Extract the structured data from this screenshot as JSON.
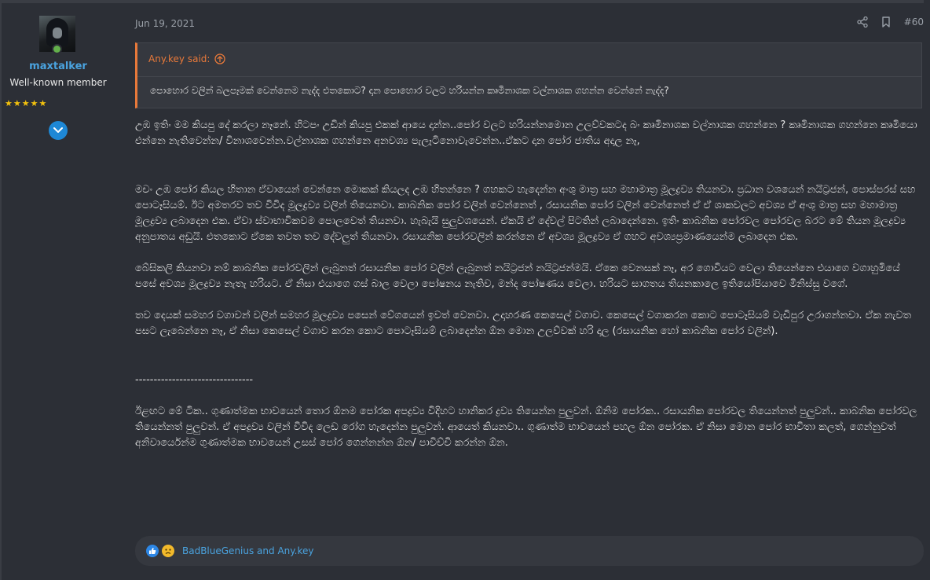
{
  "user": {
    "name": "maxtalker",
    "title": "Well-known member",
    "stars": "★★★★★",
    "avatar_icon": "user-avatar",
    "online_color": "#63b04b"
  },
  "post": {
    "date": "Jun 19, 2021",
    "number": "#60"
  },
  "quote": {
    "author": "Any.key said:",
    "text": "පොහොර වලින් බලපෑමක් වෙන්නෙම නැද්ද එතකොට? දාන පොහොර වලට හරියන්න කෘමිනාශක වල්නාශක ගහන්න වෙන්නේ නැද්ද?"
  },
  "body": {
    "p1": "උඹ ඉතිං මම කියපු දේ කරලා නෑනේ. හිටපං උඩින් කියපු එකක් ආයෙ දාන්න..පෝර වලට හරියන්නමොන උලව්වකටද බං කෘමිනාශක වල්නාශක ගහන්නෙ ? කෘමිනාශක ගහන්නෙ කෘමියො එන්නෙ නැතිවෙන්න/ විනාශවෙන්න.වල්නාශක ගහන්නෙ අනවශ්‍ය පැලෑටිනොවැවෙන්න..ඒකට දාන පෝර ජාතිය අදාල නෑ,",
    "p2": "මචං උඹ පෝර කියල හිතාන ඒවායෙන් වෙන්නෙ මොකක් කියලද උඹ හිතන්නෙ ? ගහකට හැදෙන්න අංශු මාත්‍ර සහ මහාමාත්‍ර මූලද්‍රව්‍ය තියනවා. ප්‍රධාන වශයෙන් නයිට්‍රජන්, පොස්පරස් සහ පොටෑසියම්. ඊට අමතරව තව විවිද මූලද්‍රව්‍ය වලින් තියෙනවා. කාබනික පෝර වලින් වෙන්නෙත් , රසායනික පෝර වලින් වෙන්නෙත් ඒ ඒ ශාකවලට අවශ්‍ය ඒ අංශු මාත්‍ර සහ මහාමාත්‍ර මූලද්‍රව්‍ය ලබාදෙන එක. ඒවා ස්වාභාවිකවම පොලවෙත් තියනවා. හැබැයි සුලුවශයෙන්. ඒකයි ඒ දේවල් පිටතින් ලබාදෙන්නෙ. ඉතිං කාබනික පෝරවල පෝරවල බරට මේ තියන මූලද්‍රව්‍ය අනුපාතය අඩුයි. එතකොට ඒකෙ තවත තව දේවලුත් තියනවා. රසායනික පෝරවලින් කරන්නෙ ඒ අවශ්‍ය මූලද්‍රව්‍ය ඒ ගහට අවශ්‍යප්‍රමාණයෙන්ම ලබාදෙන එක.",
    "p3": "බේසිකලි කියනවා නම් කාබනික පෝරවලින් ලැබුනත් රසායනික පෝර වලින් ලැබුනත් නයිට්‍රජන් නයිට්‍රජන්මයි. ඒකෙ වෙනසක් නෑ, අර ගොවියට වෙලා තියෙන්නෙ එයාගෙ වගාහුමියේ පසේ අවශ්‍ය මූලද්‍රව්‍ය නැතැ හරියට. ඒ නිසා එයාගෙ ගස් බාල වෙලා පෝෂනය නැතිව, මන්ද පෝෂණය වෙලා. හරියට සාගතය තියනකාලෙ ඉතියෝපියාවෙ මිනිස්සු වගේ.",
    "p4": "තව දෙයක් සමහර වගාවන් වලින් සමහර මූලද්‍රව්‍ය පසෙන් වේගයෙන් ඉවත් වෙනවා. උදාහරණ කෙසෙල් වගාව. කෙසෙල් වගාකරන කොට පොටෑසියම් වැඩිපුර උරාගන්නවා. ඒක නැවත පසට ලැබෙන්නෙ නෑ, ඒ නිසා කෙසෙල් වගාව කරන කොට පොටෑසියම් ලබාදෙන්න ඕන මොන උලව්වක් හරි දාල (රසායනික හෝ කාබනික පෝර වලින්).",
    "separator": "--------------------------------",
    "p5": "ඊළඟට මේ ටික.. ගුණාත්මක භාවයෙන් තොර ඕනම පෝරක අපද්‍රව්‍ය විදිහට හානිකර ද්‍රව්‍ය තියෙන්න පුලුවන්. ඕනිම පෝරක.. රසායනික පෝරවල තියෙන්නත් පුලුවන්.. කාබනික පෝරවල තියෙන්නත් පුලුවන්. ඒ අපද්‍රව්‍ය වලින් විවිද ලෙඩ රෝග හැදෙන්න පුලුවන්. ආයෙත් කියනවා.. ගුණාත්ම භාවයෙන් පහල ඕන පෝරක. ඒ නිසා මොන පෝර භාවිතා කලත්, ගෙන්නුවත් අනිවාර්යෙන්ම ගුණාත්මක භාවයෙන් උසස් පෝර ගෙන්නන්න ඕන/ පාවිච්චි කරන්න ඕන."
  },
  "reactions": {
    "names": "BadBlueGenius and Any.key",
    "icons": [
      "like-icon",
      "sad-icon"
    ],
    "like_color": "#2d87e6",
    "sad_color": "#f2b92b"
  },
  "colors": {
    "background": "#2c2f36",
    "link": "#4aa3df",
    "quote_accent": "#e8793a"
  }
}
